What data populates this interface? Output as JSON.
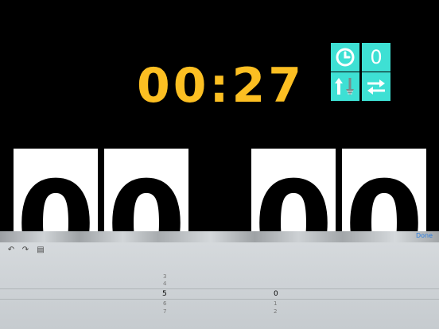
{
  "timer": {
    "display": "00:27"
  },
  "controls": {
    "clock_icon": "clock-icon",
    "zero_label": "0",
    "direction_icon": "count-direction-icon",
    "swap_icon": "swap-arrows-icon"
  },
  "flip_cards": [
    {
      "digit": "0"
    },
    {
      "digit": "0"
    },
    {
      "digit": "0"
    },
    {
      "digit": "0"
    }
  ],
  "keyboard": {
    "done_label": "Done",
    "undo_icon": "undo-icon",
    "redo_icon": "redo-icon",
    "paste_icon": "paste-icon"
  },
  "picker": {
    "left_column": {
      "above": [
        "3",
        "4"
      ],
      "selected": "5",
      "below": [
        "6",
        "7"
      ]
    },
    "right_column": {
      "selected": "0",
      "below": [
        "1",
        "2"
      ]
    }
  },
  "colors": {
    "timer": "#fcbf22",
    "tile": "#3ee0d4",
    "done": "#2d7fe0"
  }
}
